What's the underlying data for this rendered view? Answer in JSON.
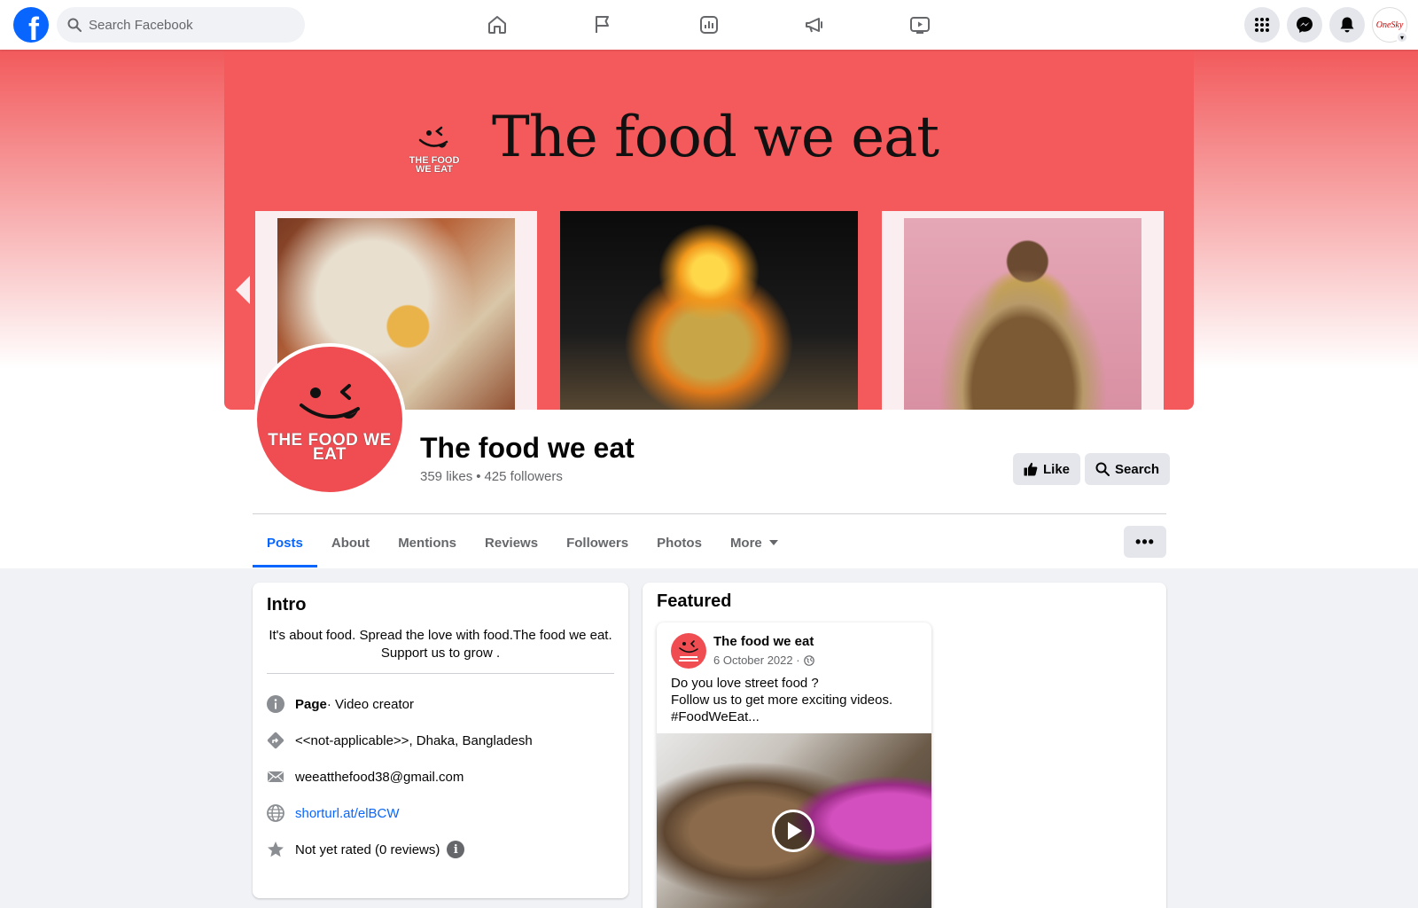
{
  "topbar": {
    "search_placeholder": "Search Facebook",
    "nav_icons": [
      "home-icon",
      "flag-icon",
      "insights-icon",
      "megaphone-icon",
      "video-icon"
    ],
    "right_icons": [
      "menu-grid-icon",
      "messenger-icon",
      "notifications-icon"
    ],
    "account_label": "OneSky"
  },
  "cover": {
    "title": "The food we eat",
    "logo_text": "THE FOOD WE EAT",
    "accent_color": "#f4595b"
  },
  "profile": {
    "logo_text": "THE FOOD WE EAT",
    "name": "The food we eat",
    "likes": "359 likes",
    "separator": "•",
    "followers": "425 followers"
  },
  "actions": {
    "like_label": "Like",
    "search_label": "Search"
  },
  "tabs": {
    "posts": "Posts",
    "about": "About",
    "mentions": "Mentions",
    "reviews": "Reviews",
    "followers": "Followers",
    "photos": "Photos",
    "more": "More",
    "active": "Posts"
  },
  "intro": {
    "title": "Intro",
    "bio_line1": "It's about food. Spread the love with food.The food we eat.",
    "bio_line2": "Support us to grow .",
    "page_type_bold": "Page",
    "page_type_rest": " · Video creator",
    "location": "<<not-applicable>>, Dhaka, Bangladesh",
    "email": "weeatthefood38@gmail.com",
    "website": "shorturl.at/elBCW",
    "rating": "Not yet rated (0 reviews)"
  },
  "featured": {
    "title": "Featured",
    "post": {
      "author": "The food we eat",
      "date": "6 October 2022 ·",
      "text_line1": "Do you love street food ?",
      "text_line2": "Follow us to get more exciting videos.",
      "text_line3": "#FoodWeEat..."
    }
  }
}
